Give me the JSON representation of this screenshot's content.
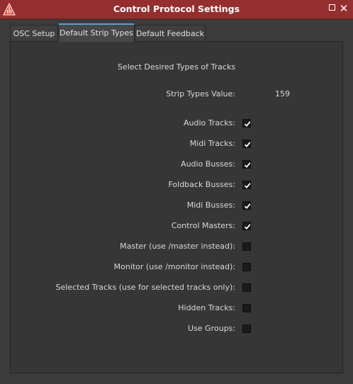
{
  "window": {
    "title": "Control Protocol Settings",
    "logo_icon": "ardour-logo-icon",
    "maximize_icon": "maximize-icon",
    "close_icon": "close-icon",
    "titlebar_color": "#952f2f"
  },
  "tabs": [
    {
      "label": "OSC Setup",
      "active": false
    },
    {
      "label": "Default Strip Types",
      "active": true
    },
    {
      "label": "Default Feedback",
      "active": false
    }
  ],
  "panel": {
    "header": "Select Desired Types of Tracks",
    "strip_types_label": "Strip Types Value:",
    "strip_types_value": "159",
    "options": [
      {
        "label": "Audio Tracks:",
        "checked": true
      },
      {
        "label": "Midi Tracks:",
        "checked": true
      },
      {
        "label": "Audio Busses:",
        "checked": true
      },
      {
        "label": "Foldback Busses:",
        "checked": true
      },
      {
        "label": "Midi Busses:",
        "checked": true
      },
      {
        "label": "Control Masters:",
        "checked": true
      },
      {
        "label": "Master (use /master instead):",
        "checked": false
      },
      {
        "label": "Monitor (use /monitor instead):",
        "checked": false
      },
      {
        "label": "Selected Tracks (use for selected tracks only):",
        "checked": false
      },
      {
        "label": "Hidden Tracks:",
        "checked": false
      },
      {
        "label": "Use Groups:",
        "checked": false
      }
    ]
  }
}
